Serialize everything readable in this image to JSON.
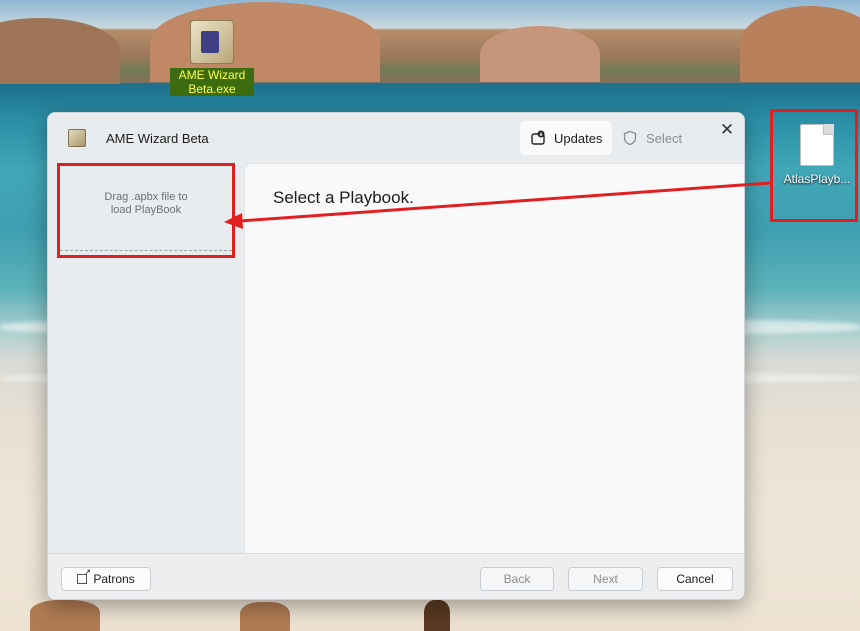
{
  "desktop": {
    "icons": [
      {
        "label": "AME Wizard Beta.exe"
      },
      {
        "label": "AtlasPlayb..."
      }
    ]
  },
  "window": {
    "title": "AME Wizard Beta",
    "tabs": [
      {
        "label": "Updates",
        "icon": "updates-icon",
        "active": true
      },
      {
        "label": "Select",
        "icon": "shield-icon",
        "active": false
      }
    ],
    "close_glyph": "✕"
  },
  "sidebar": {
    "dropzone_text": "Drag .apbx file to load PlayBook"
  },
  "main": {
    "heading": "Select a Playbook."
  },
  "footer": {
    "patrons_label": "Patrons",
    "back_label": "Back",
    "next_label": "Next",
    "cancel_label": "Cancel"
  },
  "annotation_color": "#e02020"
}
